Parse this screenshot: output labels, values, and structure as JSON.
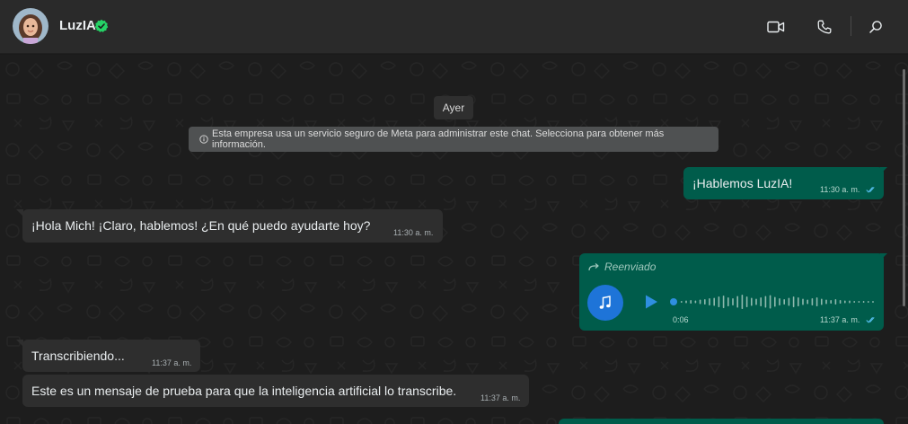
{
  "header": {
    "contact_name": "LuzIA",
    "verified_icon": "verified-check-icon",
    "actions": [
      {
        "icon": "video-call-icon"
      },
      {
        "icon": "voice-call-icon"
      },
      {
        "icon": "search-icon"
      }
    ]
  },
  "chat": {
    "date_chip": "Ayer",
    "info_banner": "Esta empresa usa un servicio seguro de Meta para administrar este chat. Selecciona para obtener más información.",
    "messages": [
      {
        "direction": "out",
        "text": "¡Hablemos LuzIA!",
        "time": "11:30 a. m.",
        "status": "read"
      },
      {
        "direction": "in",
        "text": "¡Hola Mich! ¡Claro, hablemos! ¿En qué puedo ayudarte hoy?",
        "time": "11:30 a. m."
      },
      {
        "direction": "out",
        "type": "audio",
        "forwarded_label": "Reenviado",
        "duration": "0:06",
        "time": "11:37 a. m.",
        "status": "read"
      },
      {
        "direction": "in",
        "text": "Transcribiendo...",
        "time": "11:37 a. m."
      },
      {
        "direction": "in",
        "text": "Este es un mensaje de prueba para que la inteligencia artificial lo transcribe.",
        "time": "11:37 a. m."
      }
    ]
  },
  "colors": {
    "header_bg": "#2a2a2a",
    "chat_bg": "#1d1d1d",
    "outgoing_bubble": "#005c4b",
    "incoming_bubble": "#2e2e2e",
    "verified_green": "#25d366",
    "read_ticks": "#53bdeb",
    "audio_accent": "#1e74d8"
  }
}
